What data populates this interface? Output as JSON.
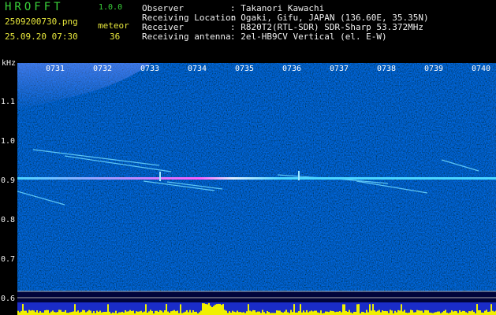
{
  "header": {
    "app_name": "HROFFT",
    "app_version": "1.0.0",
    "file_name": "2509200730.png",
    "mode_label": "meteor",
    "datetime": "25.09.20 07:30",
    "count": "36"
  },
  "info": [
    {
      "label": "Observer",
      "value": ": Takanori Kawachi"
    },
    {
      "label": "Receiving Location",
      "value": ": Ogaki, Gifu, JAPAN (136.60E, 35.35N)"
    },
    {
      "label": "Receiver",
      "value": ": R820T2(RTL-SDR) SDR-Sharp 53.372MHz"
    },
    {
      "label": "Receiving antenna",
      "value": ": 2el-HB9CV Vertical (el. E-W)"
    }
  ],
  "axis": {
    "unit": "kHz",
    "y_ticks": [
      "1.1",
      "1.0",
      "0.9",
      "0.8",
      "0.7",
      "0.6"
    ],
    "x_ticks": [
      "0731",
      "0732",
      "0733",
      "0734",
      "0735",
      "0736",
      "0737",
      "0738",
      "0739",
      "0740"
    ]
  },
  "colors": {
    "background": "#000000",
    "spectrogram": "#00086a",
    "carrier": "#4cd7ff",
    "power_bar": "#f0f000",
    "label_green": "#3ad23a",
    "label_yellow": "#e8e83c"
  }
}
